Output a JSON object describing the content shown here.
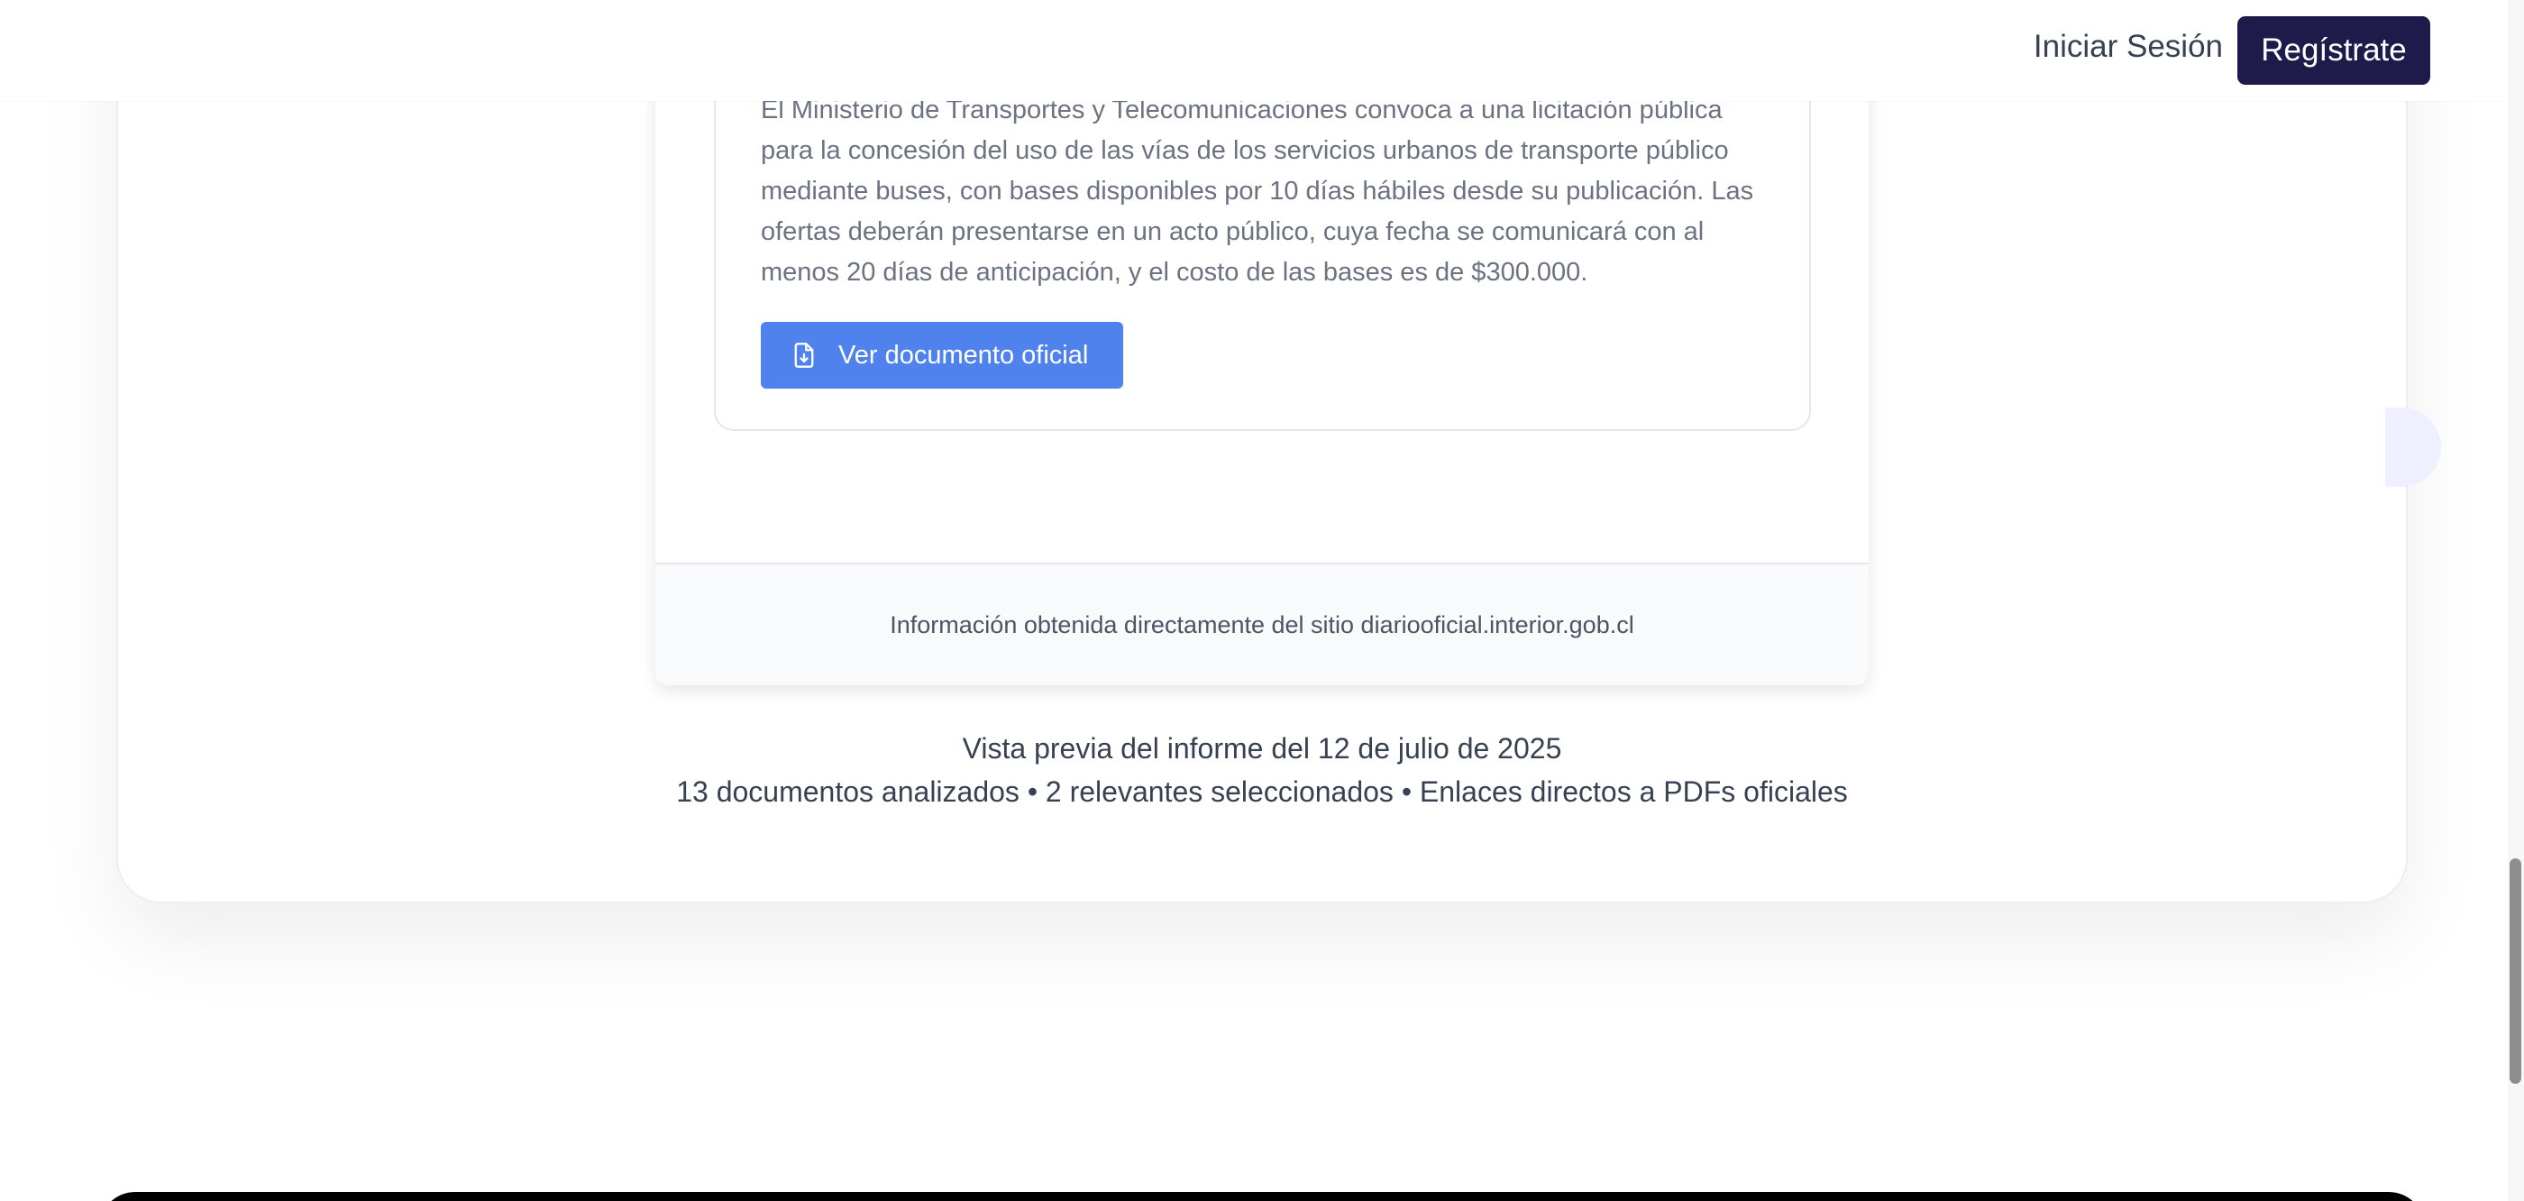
{
  "header": {
    "login_label": "Iniciar Sesión",
    "register_label": "Regístrate",
    "register_color": "#1e1b4b"
  },
  "document": {
    "description_lines": [
      "El Ministerio de Transportes y Telecomunicaciones convoca a una licitación pública",
      "para la concesión del uso de las vías de los servicios urbanos de transporte público",
      "mediante buses, con bases disponibles por 10 días hábiles desde su publicación. Las",
      "ofertas deberán presentarse en un acto público, cuya fecha se comunicará con al",
      "menos 20 días de anticipación, y el costo de las bases es de $300.000."
    ],
    "button_label": "Ver documento oficial",
    "button_icon": "file-download-icon",
    "button_color": "#4f82ec"
  },
  "report": {
    "source_note": "Información obtenida directamente del sitio diariooficial.interior.gob.cl"
  },
  "summary": {
    "title": "Vista previa del informe del 12 de julio de 2025",
    "stats": "13 documentos analizados • 2 relevantes seleccionados • Enlaces directos a PDFs oficiales"
  }
}
